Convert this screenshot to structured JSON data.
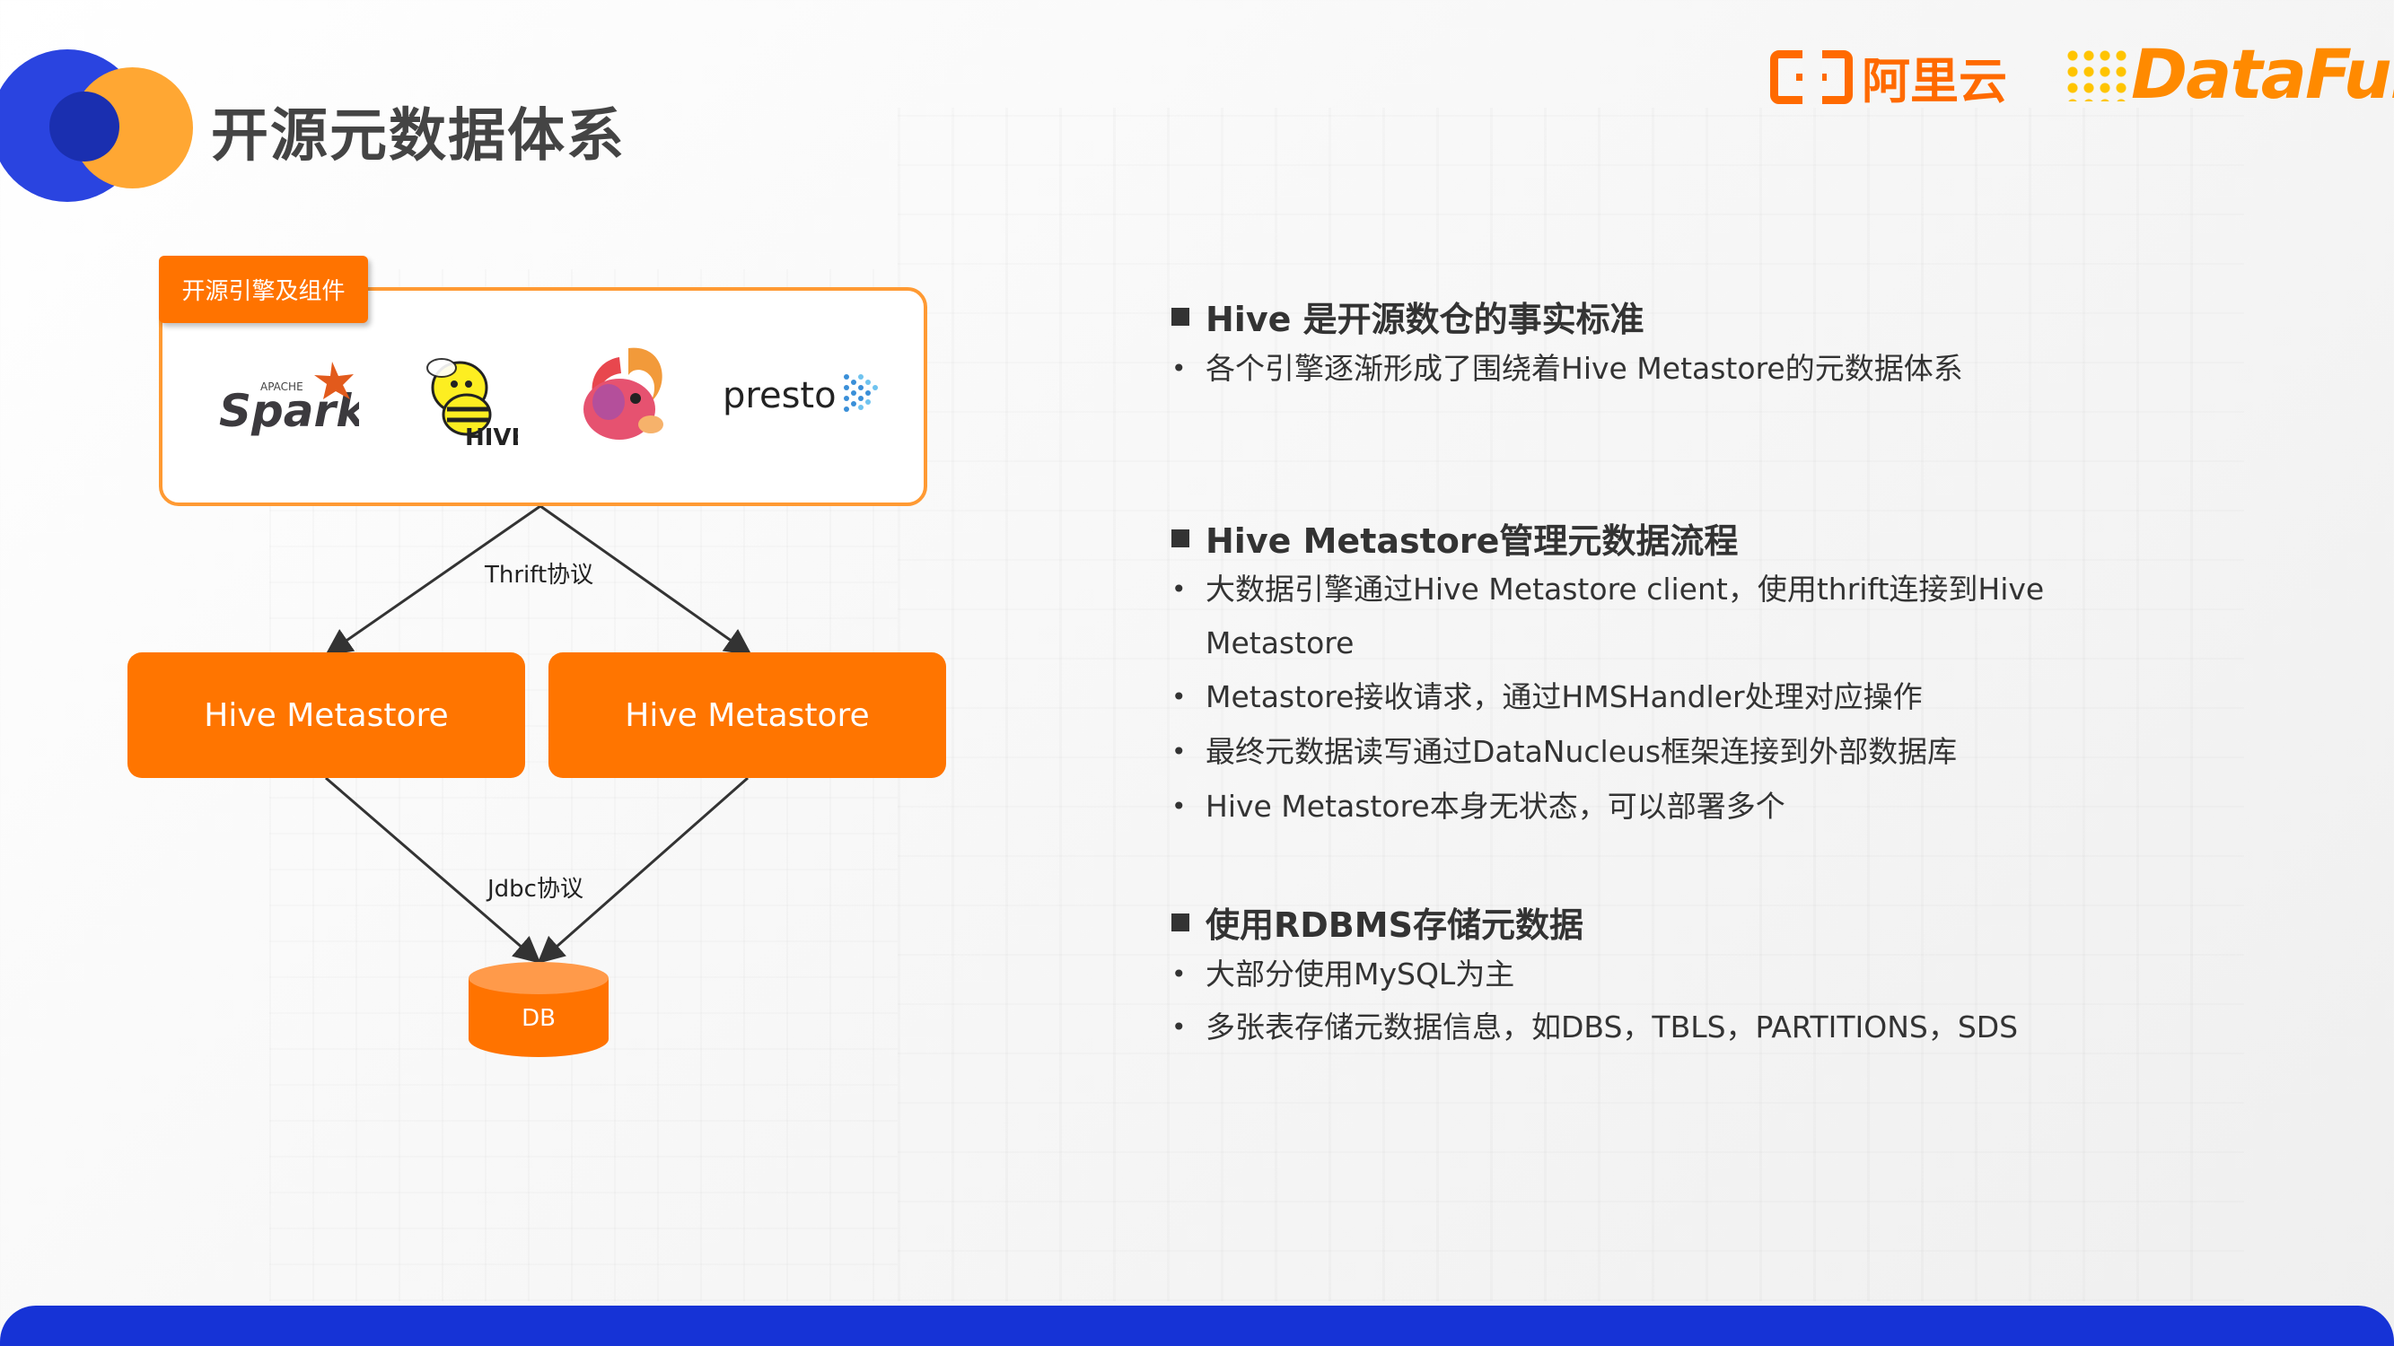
{
  "header": {
    "title": "开源元数据体系",
    "aliyun_text": "阿里云",
    "datafun_text": "DataFun."
  },
  "diagram": {
    "engine_group_label": "开源引擎及组件",
    "engines": [
      {
        "name": "Spark",
        "icon": "spark-logo",
        "text": "Spark",
        "sub": "APACHE"
      },
      {
        "name": "Hive",
        "icon": "hive-bee-logo",
        "text": "HIVE"
      },
      {
        "name": "Flink",
        "icon": "flink-squirrel-logo"
      },
      {
        "name": "presto",
        "icon": "presto-logo",
        "text": "presto"
      }
    ],
    "thrift_label": "Thrift协议",
    "metastores": [
      "Hive Metastore",
      "Hive Metastore"
    ],
    "jdbc_label": "Jdbc协议",
    "db_label": "DB",
    "colors": {
      "accent": "#ff7500",
      "border": "#ff9a33",
      "brand_blue": "#1633d6"
    }
  },
  "sections": [
    {
      "heading": "Hive 是开源数仓的事实标准",
      "bullets": [
        "各个引擎逐渐形成了围绕着Hive Metastore的元数据体系"
      ]
    },
    {
      "heading": "Hive Metastore管理元数据流程",
      "bullets": [
        "大数据引擎通过Hive Metastore client，使用thrift连接到Hive Metastore",
        "Metastore接收请求，通过HMSHandler处理对应操作",
        "最终元数据读写通过DataNucleus框架连接到外部数据库",
        "Hive Metastore本身无状态，可以部署多个"
      ]
    },
    {
      "heading": "使用RDBMS存储元数据",
      "bullets": [
        "大部分使用MySQL为主",
        "多张表存储元数据信息，如DBS，TBLS，PARTITIONS，SDS"
      ]
    }
  ],
  "bullet_symbol": "•"
}
